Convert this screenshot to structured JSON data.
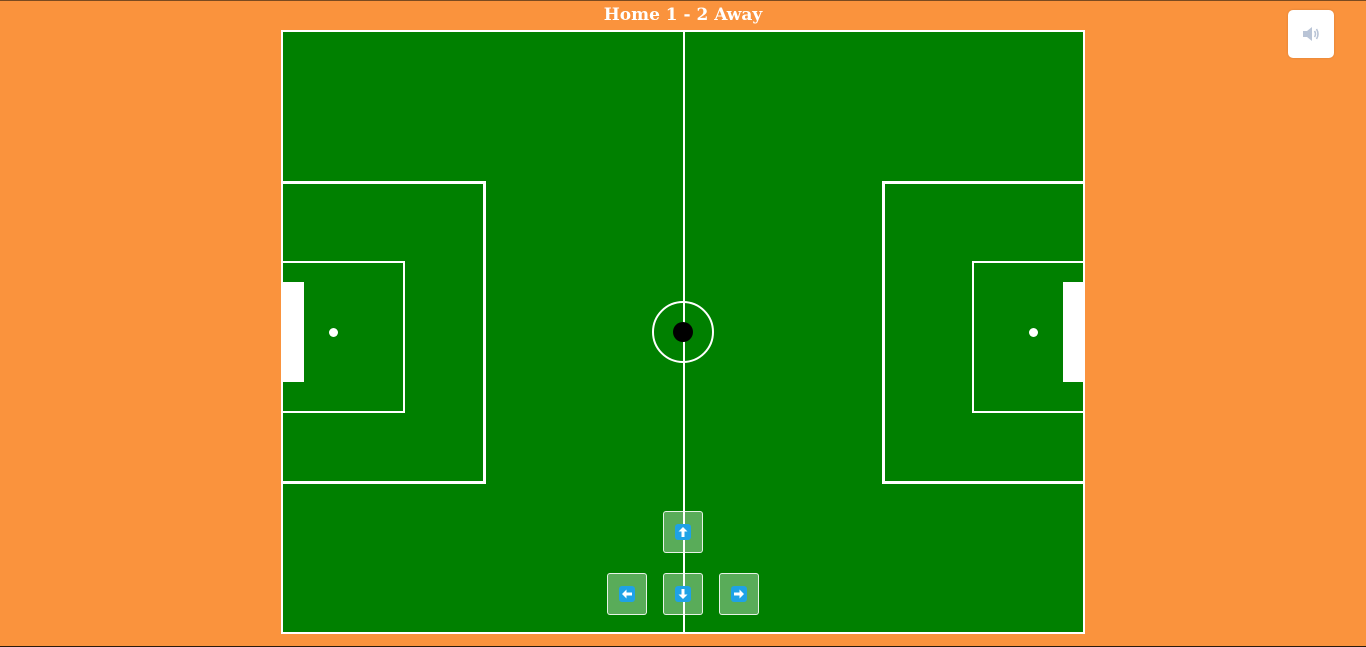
{
  "scoreboard": {
    "text": "Home 1 - 2 Away"
  },
  "sound_button": {
    "icon": "speaker-icon",
    "state": "on"
  },
  "field": {
    "grass_color": "#008000",
    "line_color": "#FFFFFF",
    "background_color": "#FA933D"
  },
  "ball": {
    "color": "#000000"
  },
  "controls": {
    "accent_color": "#1FA2E6",
    "up_icon": "arrow-up-icon",
    "left_icon": "arrow-left-icon",
    "down_icon": "arrow-down-icon",
    "right_icon": "arrow-right-icon"
  }
}
